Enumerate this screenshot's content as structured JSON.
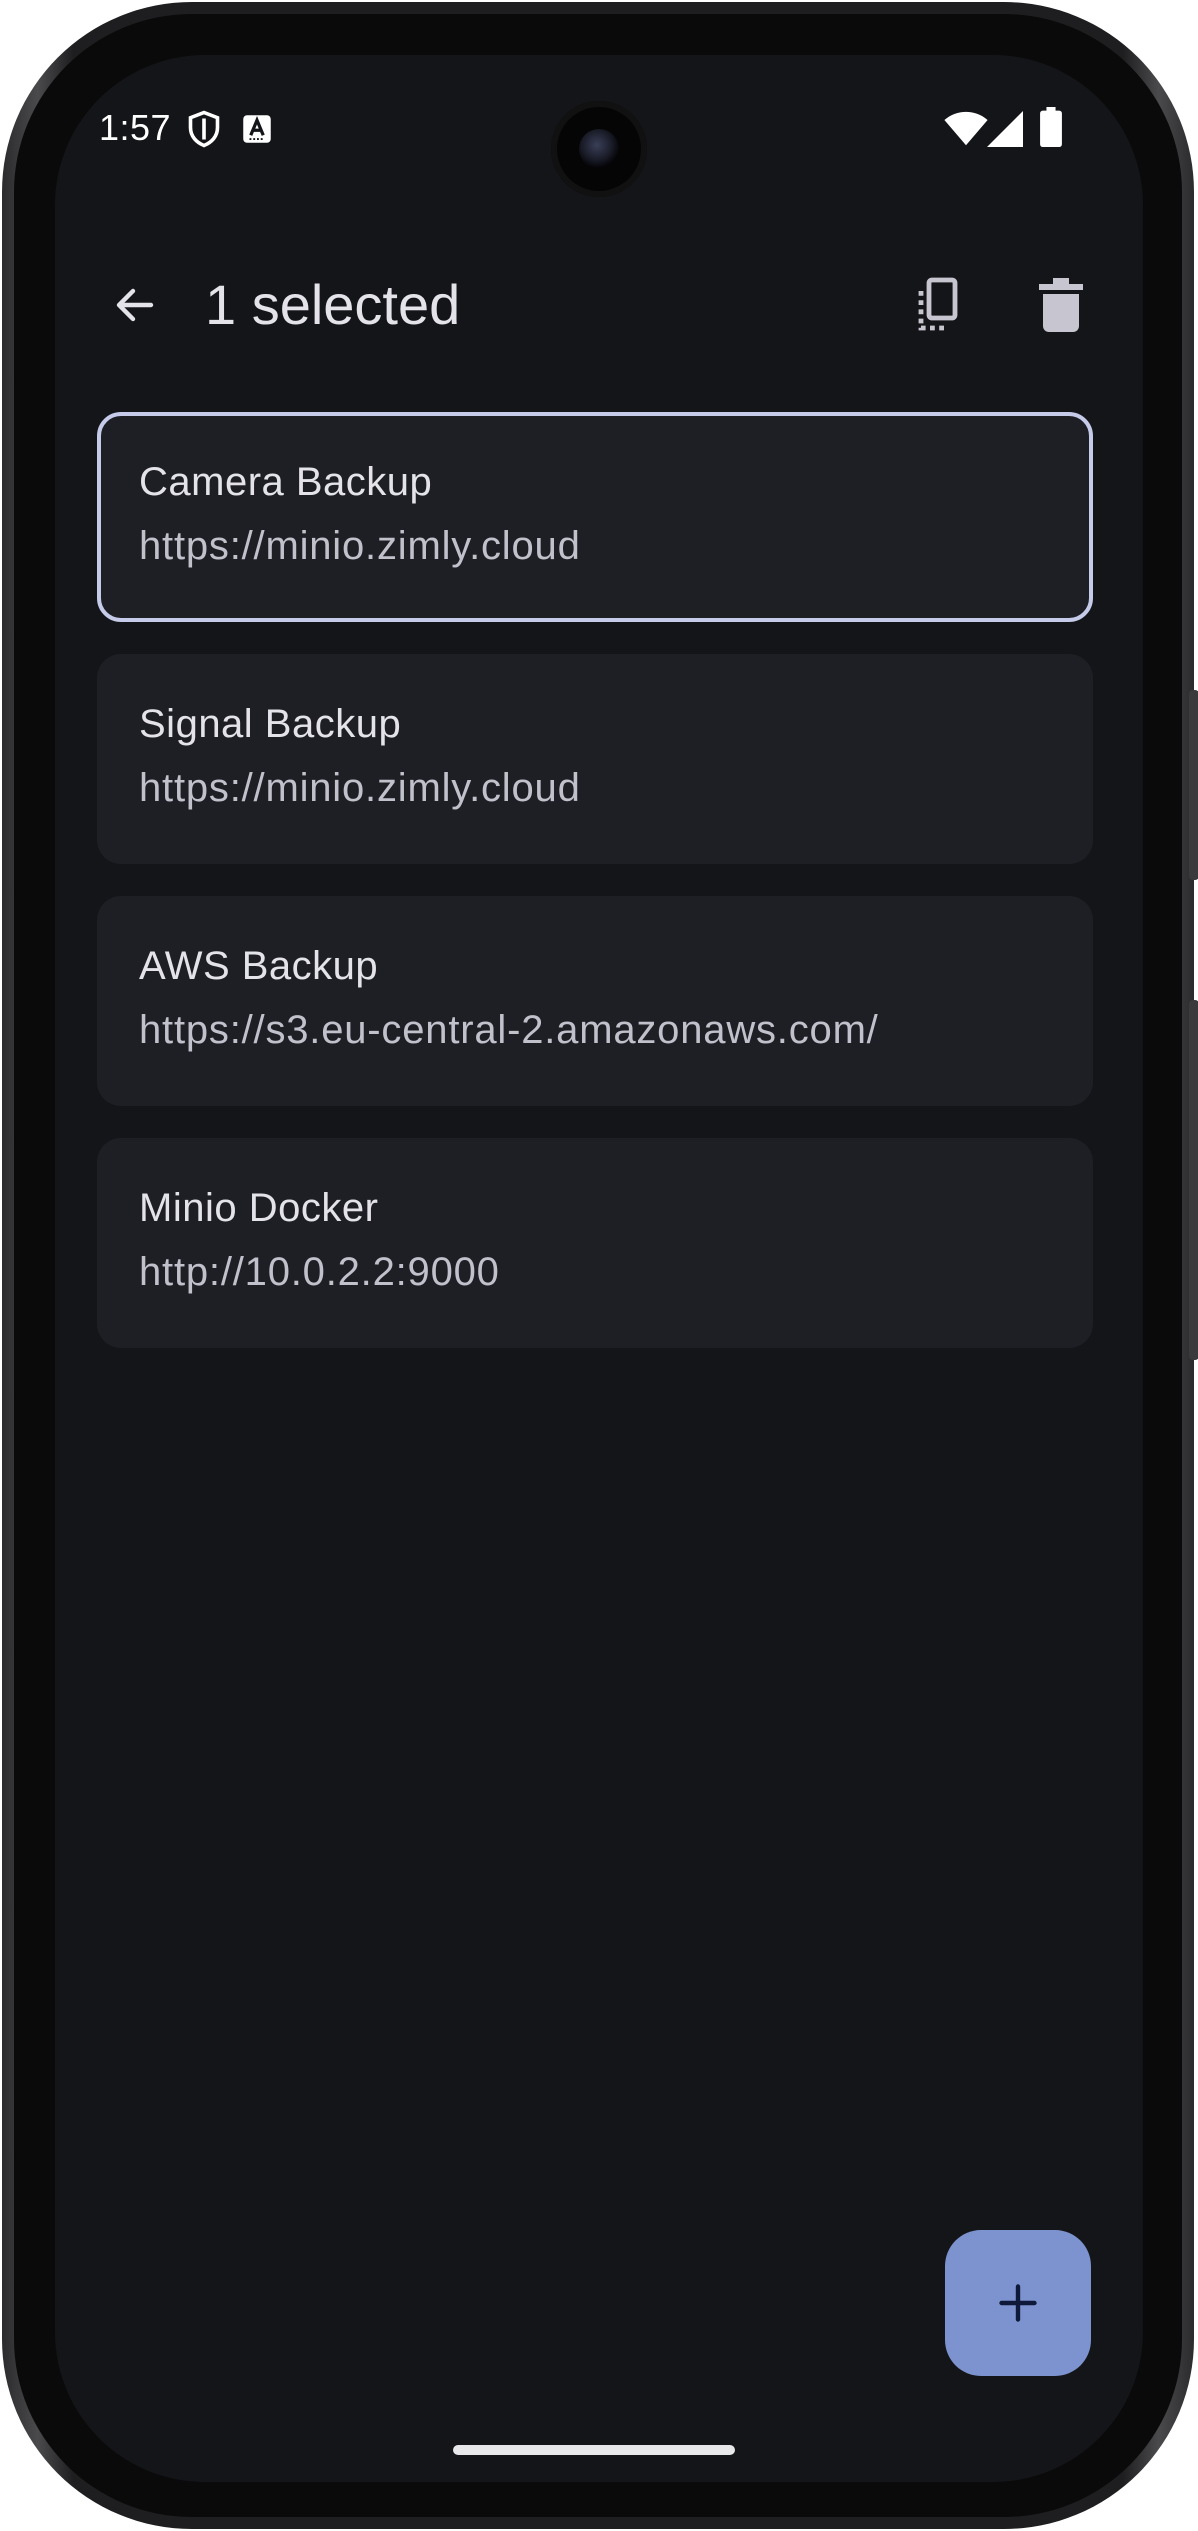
{
  "status_bar": {
    "time": "1:57",
    "icons": [
      "shield-icon",
      "keyboard-a-icon",
      "wifi-icon",
      "signal-icon",
      "battery-icon"
    ]
  },
  "app_bar": {
    "title": "1 selected",
    "back_icon": "arrow-back-icon",
    "actions": [
      "copy-icon",
      "delete-icon"
    ]
  },
  "connections": [
    {
      "name": "Camera Backup",
      "url": "https://minio.zimly.cloud",
      "selected": true
    },
    {
      "name": "Signal Backup",
      "url": "https://minio.zimly.cloud",
      "selected": false
    },
    {
      "name": "AWS Backup",
      "url": "https://s3.eu-central-2.amazonaws.com/",
      "selected": false
    },
    {
      "name": "Minio Docker",
      "url": "http://10.0.2.2:9000",
      "selected": false
    }
  ],
  "fab": {
    "icon": "plus-icon"
  },
  "colors": {
    "background": "#141519",
    "card": "#1e1f25",
    "selected_border": "#c5cbe9",
    "fab": "#7d93cf",
    "text_primary": "#e4e3ea",
    "text_secondary": "#c0c1cb"
  }
}
